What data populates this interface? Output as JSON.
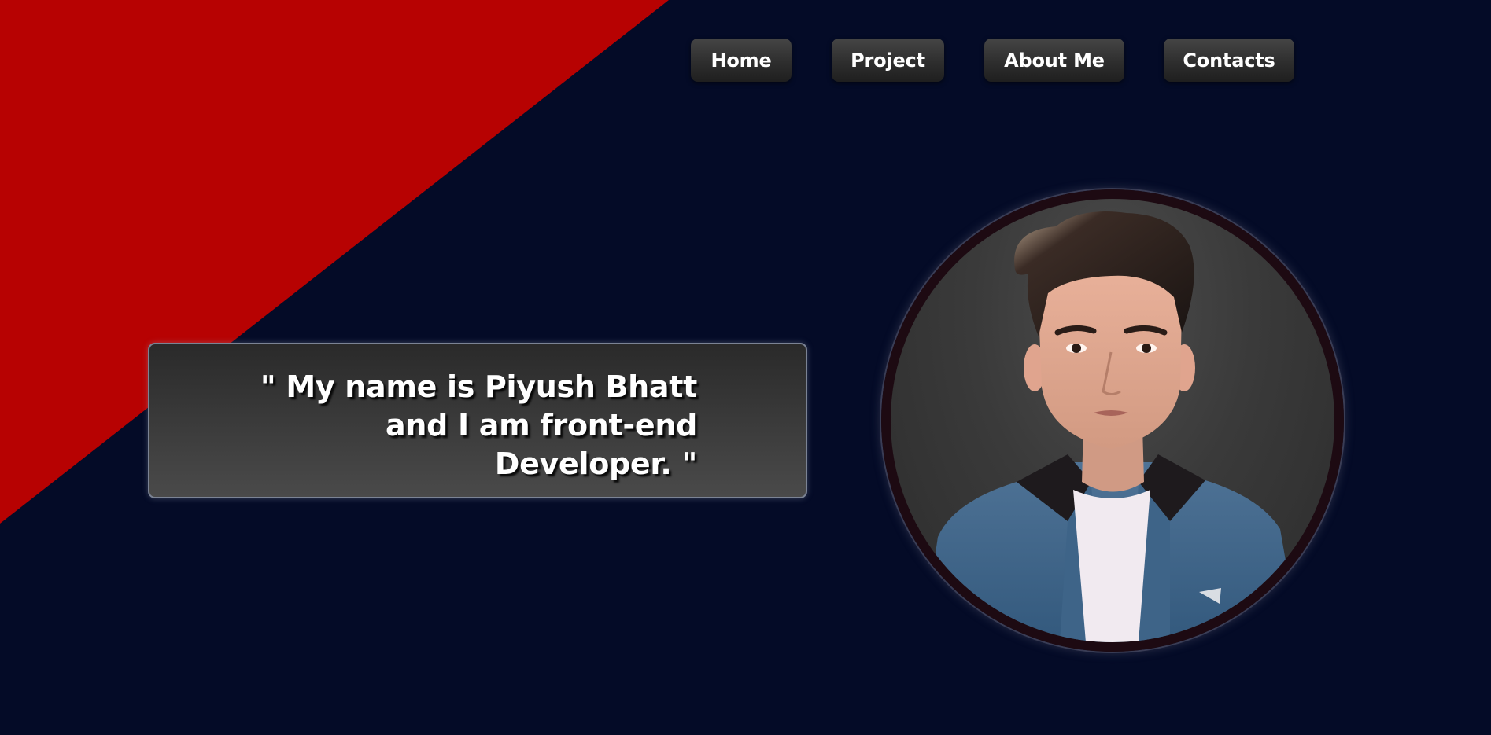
{
  "nav": {
    "items": [
      {
        "label": "Home"
      },
      {
        "label": "Project"
      },
      {
        "label": "About Me"
      },
      {
        "label": "Contacts"
      }
    ]
  },
  "intro": {
    "lines": [
      "\" My name is Piyush Bhatt",
      "and I am front-end",
      "Developer. \""
    ]
  },
  "theme": {
    "background": "#040b27",
    "accent_red": "#b70202",
    "button_bg": "#2e2e2e",
    "text": "#ffffff",
    "avatar_ring": "#1d0a12"
  },
  "avatar": {
    "icon": "profile-photo"
  }
}
